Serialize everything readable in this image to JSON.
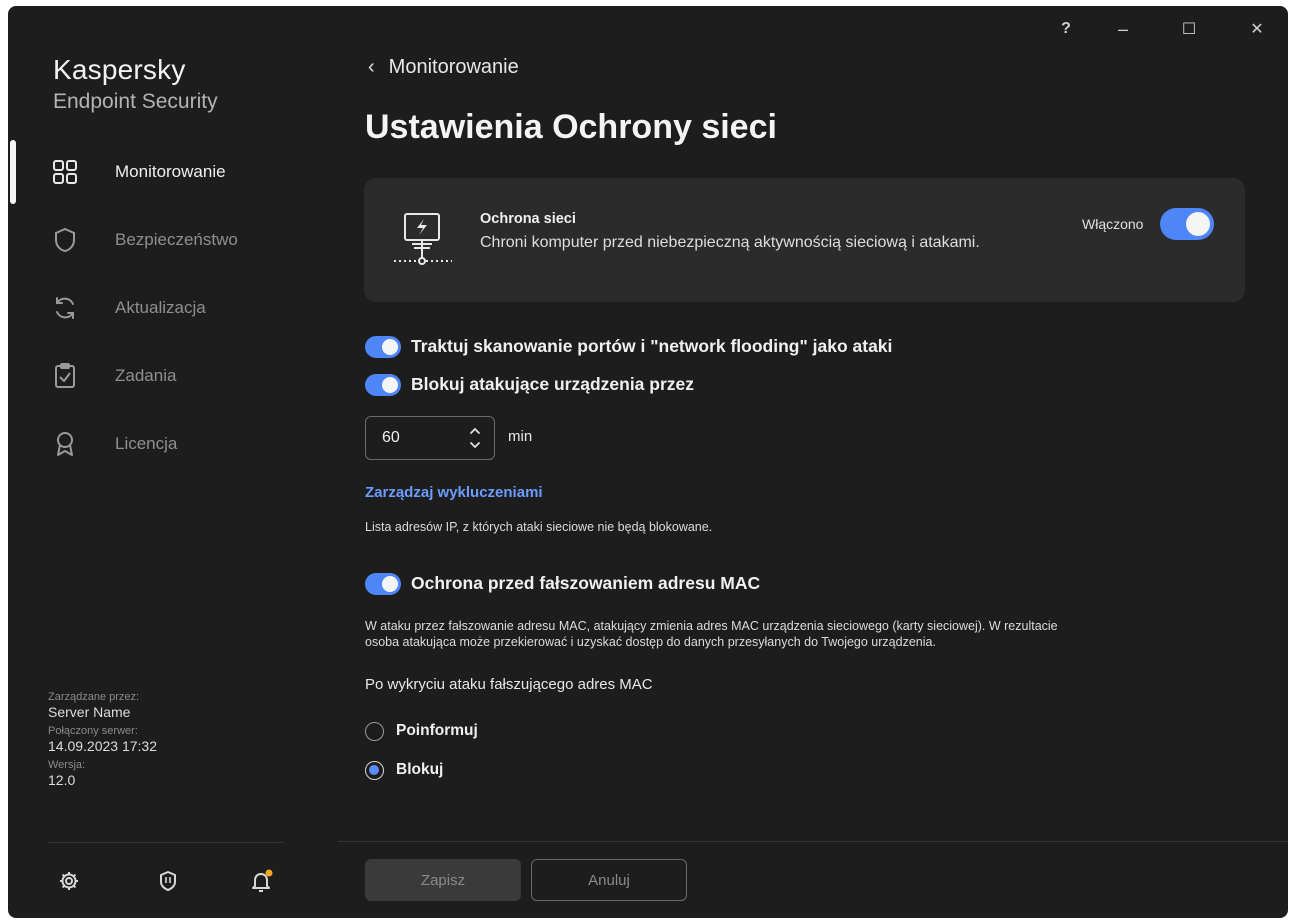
{
  "app": {
    "brand_name": "Kaspersky",
    "brand_product": "Endpoint Security"
  },
  "titlebar": {
    "help": "?",
    "minimize": "–",
    "maximize": "☐",
    "close": "✕"
  },
  "sidebar": {
    "items": [
      {
        "label": "Monitorowanie",
        "icon": "dashboard-icon",
        "active": true
      },
      {
        "label": "Bezpieczeństwo",
        "icon": "shield-icon",
        "active": false
      },
      {
        "label": "Aktualizacja",
        "icon": "refresh-icon",
        "active": false
      },
      {
        "label": "Zadania",
        "icon": "clipboard-check-icon",
        "active": false
      },
      {
        "label": "Licencja",
        "icon": "award-icon",
        "active": false
      }
    ],
    "managed_by_label": "Zarządzane przez:",
    "managed_by_value": "Server Name",
    "connected_label": "Połączony serwer:",
    "connected_value": "14.09.2023 17:32",
    "version_label": "Wersja:",
    "version_value": "12.0",
    "footer_icons": [
      "settings-icon",
      "support-icon",
      "notifications-icon"
    ]
  },
  "main": {
    "back_label": "Monitorowanie",
    "title": "Ustawienia Ochrony sieci",
    "card": {
      "title": "Ochrona sieci",
      "description": "Chroni komputer przed niebezpieczną aktywnością sieciową i atakami.",
      "status": "Włączono",
      "enabled": true
    },
    "option_port_scan": "Traktuj skanowanie portów i \"network flooding\" jako ataki",
    "option_block": "Blokuj atakujące urządzenia przez",
    "block_minutes": "60",
    "block_unit": "min",
    "exclusions_link": "Zarządzaj wykluczeniami",
    "exclusions_desc": "Lista adresów IP, z których ataki sieciowe nie będą blokowane.",
    "option_mac": "Ochrona przed fałszowaniem adresu MAC",
    "mac_desc_1": "W ataku przez fałszowanie adresu MAC, atakujący zmienia adres MAC urządzenia sieciowego (karty sieciowej). W rezultacie",
    "mac_desc_2": "osoba atakująca może przekierować i uzyskać dostęp do danych przesyłanych do Twojego urządzenia.",
    "after_detect_label": "Po wykryciu ataku fałszującego adres MAC",
    "radio_inform": "Poinformuj",
    "radio_block": "Blokuj",
    "selected_action": "Blokuj",
    "save_label": "Zapisz",
    "cancel_label": "Anuluj"
  },
  "colors": {
    "accent": "#4f86f7",
    "link": "#6b9cff",
    "background": "#1d1d1d",
    "card": "#2b2b2b",
    "notification_dot": "#f5a623"
  }
}
